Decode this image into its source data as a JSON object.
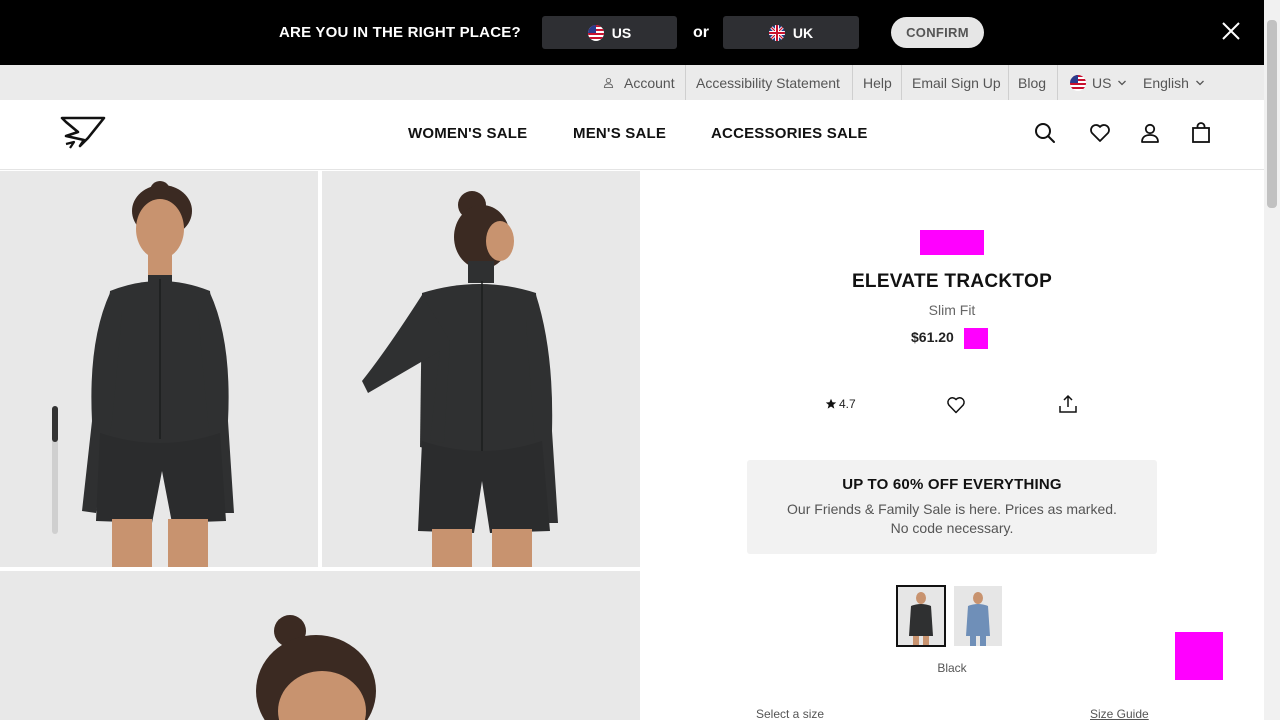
{
  "geo_banner": {
    "question": "ARE YOU IN THE RIGHT PLACE?",
    "option_us": "US",
    "or_text": "or",
    "option_uk": "UK",
    "confirm": "CONFIRM"
  },
  "utility_bar": {
    "account": "Account",
    "accessibility": "Accessibility Statement",
    "help": "Help",
    "email_signup": "Email Sign Up",
    "blog": "Blog",
    "region": "US",
    "language": "English"
  },
  "nav": {
    "womens": "WOMEN'S SALE",
    "mens": "MEN'S SALE",
    "accessories": "ACCESSORIES SALE"
  },
  "product": {
    "title": "ELEVATE TRACKTOP",
    "fit": "Slim Fit",
    "price": "$61.20",
    "rating": "4.7",
    "color_name": "Black",
    "swatches": [
      "Black",
      "Blue"
    ],
    "select_size": "Select a size",
    "size_guide": "Size Guide"
  },
  "promo": {
    "title": "UP TO 60% OFF EVERYTHING",
    "text": "Our Friends & Family Sale is here. Prices as marked. No code necessary."
  },
  "colors": {
    "banner_bg": "#000000",
    "util_bg": "#ebebeb",
    "placeholder_magenta": "#ff00ff",
    "garment": "#2f3031"
  },
  "icons": [
    "us-flag-icon",
    "uk-flag-icon",
    "close-icon",
    "user-icon",
    "chevron-down-icon",
    "search-icon",
    "heart-icon",
    "account-icon",
    "bag-icon",
    "star-icon",
    "share-icon"
  ]
}
